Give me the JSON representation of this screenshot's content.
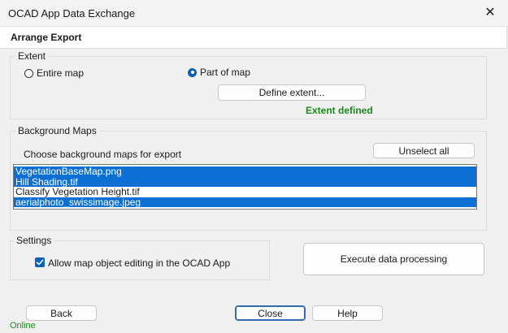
{
  "window": {
    "title": "OCAD App Data Exchange",
    "close_glyph": "✕"
  },
  "header": {
    "title": "Arrange Export"
  },
  "extent": {
    "legend": "Extent",
    "option_entire": "Entire map",
    "option_part": "Part of map",
    "selected": "Part of map",
    "define_button": "Define extent...",
    "status": "Extent defined",
    "status_color": "#1a8a1a"
  },
  "background_maps": {
    "legend": "Background Maps",
    "instruction": "Choose background maps for export",
    "unselect_button": "Unselect all",
    "items": [
      {
        "label": "VegetationBaseMap.png",
        "selected": true
      },
      {
        "label": "Hill Shading.tif",
        "selected": true
      },
      {
        "label": "Classify Vegetation Height.tif",
        "selected": false
      },
      {
        "label": "aerialphoto_swissimage.jpeg",
        "selected": true
      }
    ],
    "selection_color": "#0c6fd3"
  },
  "settings": {
    "legend": "Settings",
    "allow_editing_label": "Allow map object editing in the OCAD App",
    "allow_editing_checked": true
  },
  "execute_button": "Execute data processing",
  "footer": {
    "back": "Back",
    "close": "Close",
    "help": "Help",
    "status": "Online",
    "status_color": "#1a8a1a"
  }
}
